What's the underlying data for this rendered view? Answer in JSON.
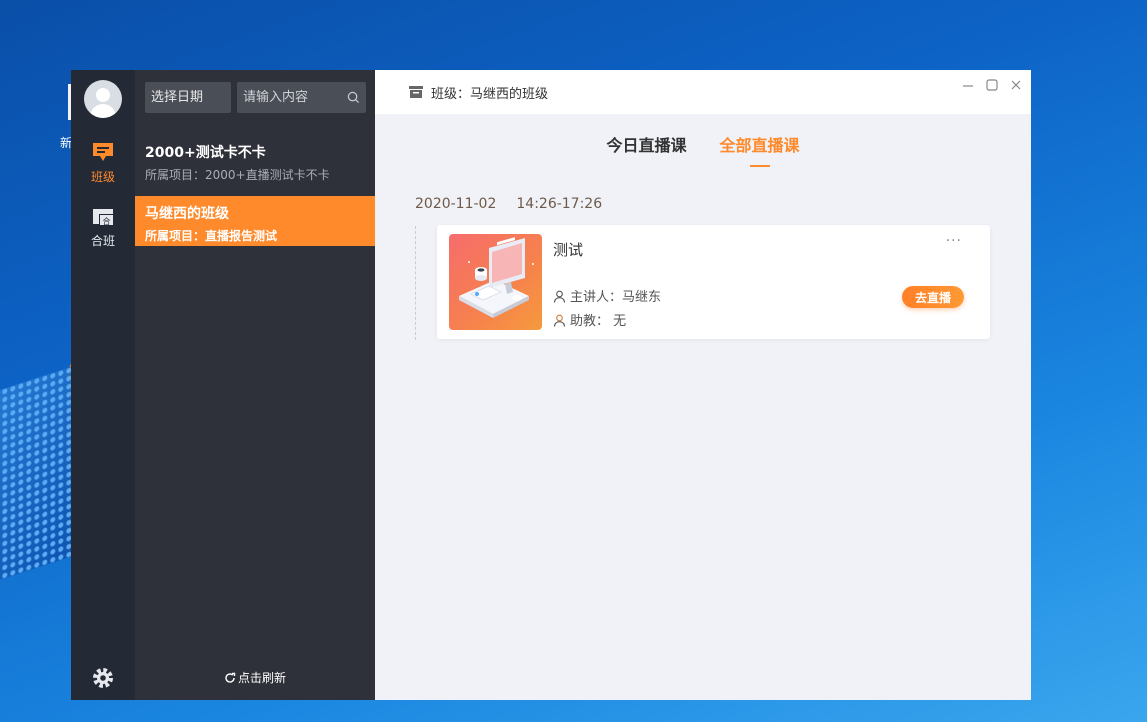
{
  "desktop": {
    "icon_label": "新"
  },
  "rail": {
    "items": [
      {
        "label": "班级",
        "icon": "class-icon",
        "active": true
      },
      {
        "label": "合班",
        "icon": "merge-class-icon",
        "active": false
      }
    ],
    "settings_icon": "gear-icon"
  },
  "sidebar": {
    "date_button": "选择日期",
    "search_placeholder": "请输入内容",
    "classes": [
      {
        "title": "2000+测试卡不卡",
        "subtitle": "所属项目：2000+直播测试卡不卡"
      },
      {
        "title": "马继西的班级",
        "subtitle": "所属项目：直播报告测试"
      }
    ],
    "refresh_label": "点击刷新"
  },
  "header": {
    "title": "班级：马继西的班级"
  },
  "tabs": [
    {
      "label": "今日直播课",
      "active": false
    },
    {
      "label": "全部直播课",
      "active": true
    }
  ],
  "schedule": {
    "date": "2020-11-02",
    "time": "14:26-17:26",
    "card": {
      "title": "测试",
      "more": "···",
      "lecturer": "主讲人：马继东",
      "assistant": "助教：  无",
      "action": "去直播"
    }
  },
  "colors": {
    "accent": "#ff8a2b",
    "rail": "#232a36",
    "sidebar": "#2e3139",
    "content_bg": "#f0f2f8"
  }
}
